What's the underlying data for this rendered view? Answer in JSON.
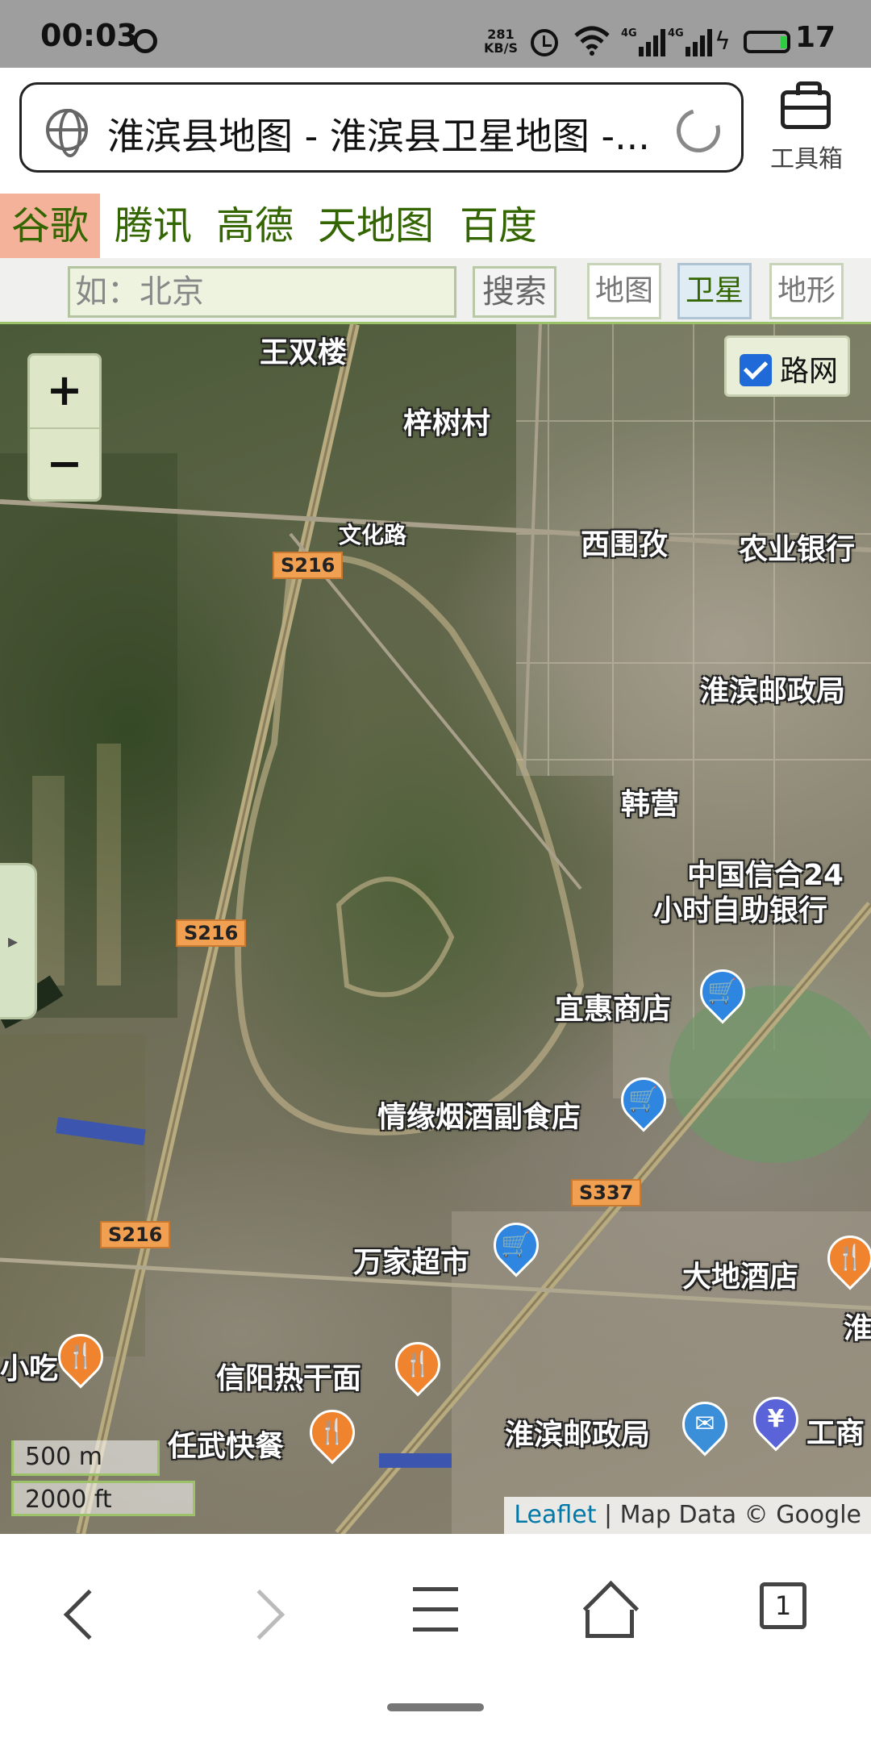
{
  "status_bar": {
    "time": "00:03",
    "net_speed_value": "281",
    "net_speed_unit": "KB/S",
    "signal1_label": "4G",
    "signal2_label": "4G",
    "battery": "17"
  },
  "browser": {
    "url_title": "淮滨县地图 - 淮滨县卫星地图 -...",
    "toolbox_label": "工具箱"
  },
  "providers": [
    {
      "label": "谷歌",
      "active": true
    },
    {
      "label": "腾讯",
      "active": false
    },
    {
      "label": "高德",
      "active": false
    },
    {
      "label": "天地图",
      "active": false
    },
    {
      "label": "百度",
      "active": false
    }
  ],
  "search": {
    "placeholder": "如：北京",
    "button": "搜索"
  },
  "map_types": [
    {
      "label": "地图",
      "active": false
    },
    {
      "label": "卫星",
      "active": true
    },
    {
      "label": "地形",
      "active": false
    }
  ],
  "map": {
    "zoom_in": "+",
    "zoom_out": "−",
    "road_net_label": "路网",
    "road_net_checked": true,
    "side_tab_glyph": "▸",
    "labels": {
      "wangshuanglou": "王双楼",
      "zishucun": "梓树村",
      "wenhualu": "文化路",
      "xiweimei": "西围孜",
      "nongyeyinhang": "农业银行",
      "youzhengju_top": "淮滨邮政局",
      "hanying": "韩营",
      "xinhe_line1": "中国信合24",
      "xinhe_line2": "小时自助银行",
      "yihui": "宜惠商店",
      "qingyuan": "情缘烟酒副食店",
      "wanjia": "万家超市",
      "dadi": "大地酒店",
      "xiaochi": "小吃",
      "xinyang": "信阳热干面",
      "renwu": "任武快餐",
      "youzhengju_bottom": "淮滨邮政局",
      "gongshang": "工商",
      "huai": "淮"
    },
    "shields": {
      "s216_top": "S216",
      "s216_mid": "S216",
      "s216_bottom": "S216",
      "s337": "S337"
    },
    "pin_colors": {
      "shop": "#2f86e0",
      "food": "#f0832e",
      "post": "#3a8fd8",
      "bank": "#5a63d8"
    },
    "pin_glyphs": {
      "shop": "🛒",
      "food": "🍴",
      "post": "✉",
      "bank": "¥"
    },
    "scale_metric": "500 m",
    "scale_imperial": "2000 ft",
    "attribution_link": "Leaflet",
    "attribution_text": " | Map Data © Google"
  },
  "bottom_nav": {
    "tab_count": "1"
  }
}
